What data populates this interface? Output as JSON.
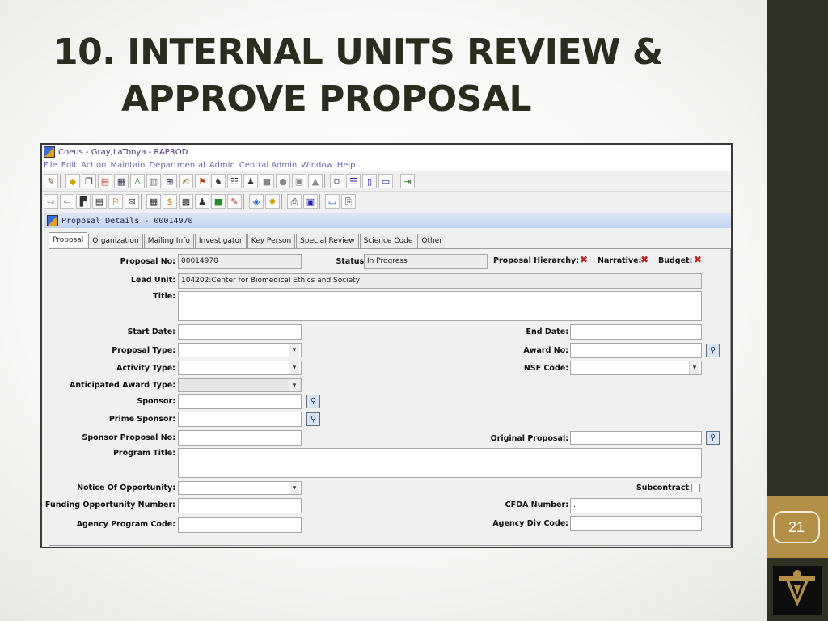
{
  "slide": {
    "title_line1": "10.  INTERNAL UNITS REVIEW &",
    "title_line2": "APPROVE PROPOSAL",
    "page_number": "21"
  },
  "window": {
    "title": "Coeus  -  Gray,LaTonya  -  RAPROD",
    "menus": [
      "File",
      "Edit",
      "Action",
      "Maintain",
      "Departmental",
      "Admin",
      "Central Admin",
      "Window",
      "Help"
    ]
  },
  "inner": {
    "title": "Proposal Details - 00014970"
  },
  "tabs": [
    "Proposal",
    "Organization",
    "Mailing Info",
    "Investigator",
    "Key Person",
    "Special Review",
    "Science Code",
    "Other"
  ],
  "form": {
    "proposal_no_label": "Proposal No:",
    "proposal_no": "00014970",
    "status_label": "Status:",
    "status": "In Progress",
    "hierarchy_label": "Proposal Hierarchy:",
    "narrative_label": "Narrative:",
    "budget_label": "Budget:",
    "lead_unit_label": "Lead Unit:",
    "lead_unit": "104202:Center for Biomedical Ethics and Society",
    "title_label": "Title:",
    "start_date_label": "Start Date:",
    "end_date_label": "End Date:",
    "proposal_type_label": "Proposal Type:",
    "award_no_label": "Award No:",
    "activity_type_label": "Activity Type:",
    "nsf_code_label": "NSF Code:",
    "anticipated_award_type_label": "Anticipated Award Type:",
    "sponsor_label": "Sponsor:",
    "prime_sponsor_label": "Prime Sponsor:",
    "sponsor_proposal_no_label": "Sponsor Proposal No:",
    "original_proposal_label": "Original Proposal:",
    "program_title_label": "Program Title:",
    "notice_of_opportunity_label": "Notice Of Opportunity:",
    "subcontract_label": "Subcontract",
    "funding_opportunity_number_label": "Funding Opportunity Number:",
    "cfda_number_label": "CFDA Number:",
    "cfda_number": ".",
    "agency_program_code_label": "Agency Program Code:",
    "agency_div_code_label": "Agency Div Code:"
  }
}
